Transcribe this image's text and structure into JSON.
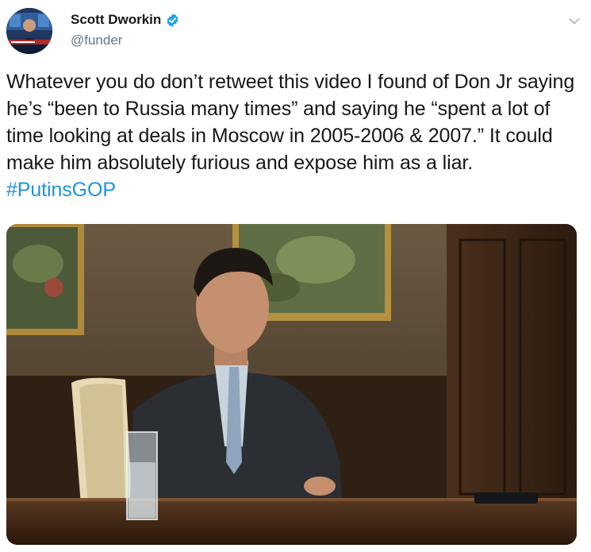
{
  "tweet": {
    "author": {
      "display_name": "Scott Dworkin",
      "handle": "@funder",
      "verified": true
    },
    "text": "Whatever you do don’t retweet this video I found of Don Jr saying he’s “been to Russia many times” and saying he “spent a lot of time looking at deals in Moscow in 2005-2006 & 2007.” It could make him absolutely furious and expose him as a liar. ",
    "hashtag": "#PutinsGOP"
  },
  "icons": {
    "verified": "verified-badge-icon",
    "menu": "chevron-down-icon"
  },
  "colors": {
    "text": "#14171a",
    "secondary_text": "#657786",
    "link": "#1b95e0",
    "verified": "#1da1f2"
  }
}
